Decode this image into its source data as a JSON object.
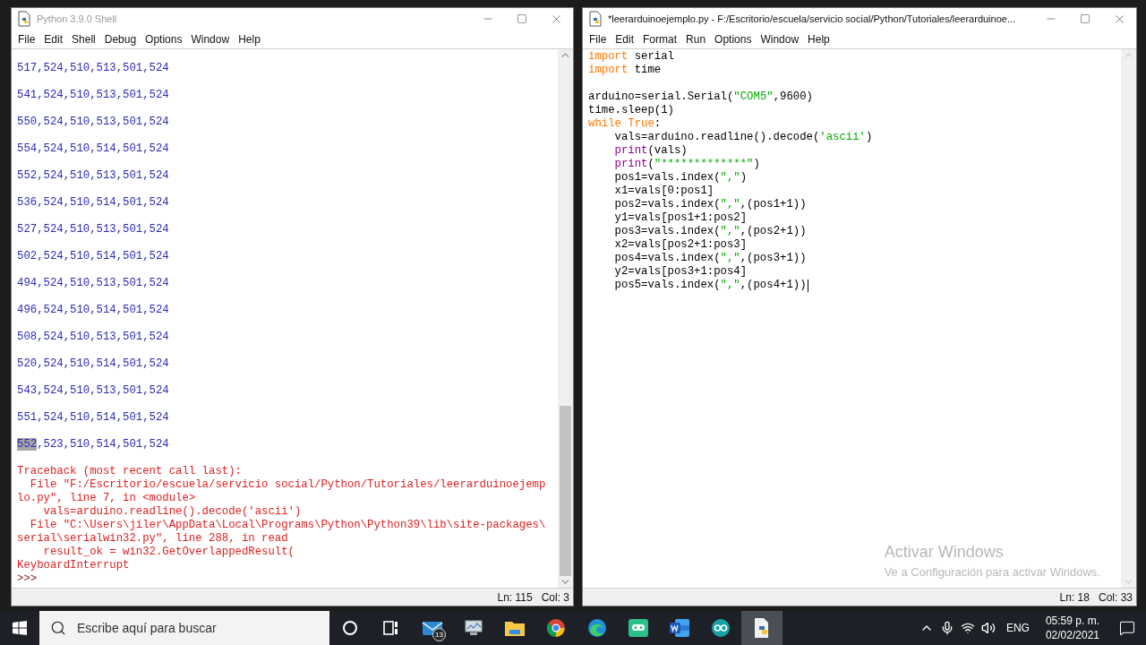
{
  "shell_window": {
    "title": "Python 3.9.0 Shell",
    "active": false,
    "menu": [
      "File",
      "Edit",
      "Shell",
      "Debug",
      "Options",
      "Window",
      "Help"
    ],
    "lines": [
      {
        "kind": "output",
        "text": "517,524,510,513,501,524"
      },
      {
        "kind": "output",
        "text": "541,524,510,513,501,524"
      },
      {
        "kind": "output",
        "text": "550,524,510,513,501,524"
      },
      {
        "kind": "output",
        "text": "554,524,510,514,501,524"
      },
      {
        "kind": "output",
        "text": "552,524,510,513,501,524"
      },
      {
        "kind": "output",
        "text": "536,524,510,514,501,524"
      },
      {
        "kind": "output",
        "text": "527,524,510,513,501,524"
      },
      {
        "kind": "output",
        "text": "502,524,510,514,501,524"
      },
      {
        "kind": "output",
        "text": "494,524,510,513,501,524"
      },
      {
        "kind": "output",
        "text": "496,524,510,514,501,524"
      },
      {
        "kind": "output",
        "text": "508,524,510,513,501,524"
      },
      {
        "kind": "output",
        "text": "520,524,510,514,501,524"
      },
      {
        "kind": "output",
        "text": "543,524,510,513,501,524"
      },
      {
        "kind": "output",
        "text": "551,524,510,514,501,524"
      },
      {
        "kind": "output",
        "segments": [
          {
            "text": "552",
            "selected": true
          },
          {
            "text": ",523,510,514,501,524",
            "selected": false
          }
        ]
      },
      {
        "kind": "error",
        "text": "Traceback (most recent call last):"
      },
      {
        "kind": "error",
        "text": "  File \"F:/Escritorio/escuela/servicio social/Python/Tutoriales/leerarduinoejemp"
      },
      {
        "kind": "error",
        "text": "lo.py\", line 7, in <module>"
      },
      {
        "kind": "error",
        "text": "    vals=arduino.readline().decode('ascii')"
      },
      {
        "kind": "error",
        "text": "  File \"C:\\Users\\jiler\\AppData\\Local\\Programs\\Python\\Python39\\lib\\site-packages\\"
      },
      {
        "kind": "error",
        "text": "serial\\serialwin32.py\", line 288, in read"
      },
      {
        "kind": "error",
        "text": "    result_ok = win32.GetOverlappedResult("
      },
      {
        "kind": "error",
        "text": "KeyboardInterrupt"
      },
      {
        "kind": "prompt",
        "text": ">>>"
      }
    ],
    "status": {
      "line": "Ln: 115",
      "col": "Col: 3"
    }
  },
  "editor_window": {
    "title": "*leerarduinoejemplo.py - F:/Escritorio/escuela/servicio social/Python/Tutoriales/leerarduinoe...",
    "active": true,
    "menu": [
      "File",
      "Edit",
      "Format",
      "Run",
      "Options",
      "Window",
      "Help"
    ],
    "lines": [
      {
        "segments": [
          {
            "text": "import",
            "kind": "keyword"
          },
          {
            "text": " serial",
            "kind": "plain"
          }
        ]
      },
      {
        "segments": [
          {
            "text": "import",
            "kind": "keyword"
          },
          {
            "text": " time",
            "kind": "plain"
          }
        ]
      },
      {
        "gap_before": true,
        "segments": [
          {
            "text": "arduino=serial.Serial(",
            "kind": "plain"
          },
          {
            "text": "\"COM5\"",
            "kind": "string"
          },
          {
            "text": ",9600)",
            "kind": "plain"
          }
        ]
      },
      {
        "segments": [
          {
            "text": "time.sleep(1)",
            "kind": "plain"
          }
        ]
      },
      {
        "segments": [
          {
            "text": "while True",
            "kind": "keyword"
          },
          {
            "text": ":",
            "kind": "plain"
          }
        ]
      },
      {
        "indent": true,
        "segments": [
          {
            "text": "vals=arduino.readline().decode(",
            "kind": "plain"
          },
          {
            "text": "'ascii'",
            "kind": "string"
          },
          {
            "text": ")",
            "kind": "plain"
          }
        ]
      },
      {
        "indent": true,
        "segments": [
          {
            "text": "print",
            "kind": "builtin"
          },
          {
            "text": "(vals)",
            "kind": "plain"
          }
        ]
      },
      {
        "indent": true,
        "segments": [
          {
            "text": "print",
            "kind": "builtin"
          },
          {
            "text": "(",
            "kind": "plain"
          },
          {
            "text": "\"*************\"",
            "kind": "string"
          },
          {
            "text": ")",
            "kind": "plain"
          }
        ]
      },
      {
        "indent": true,
        "segments": [
          {
            "text": "pos1=vals.index(",
            "kind": "plain"
          },
          {
            "text": "\",\"",
            "kind": "string"
          },
          {
            "text": ")",
            "kind": "plain"
          }
        ]
      },
      {
        "indent": true,
        "segments": [
          {
            "text": "x1=vals[0:pos1]",
            "kind": "plain"
          }
        ]
      },
      {
        "indent": true,
        "segments": [
          {
            "text": "pos2=vals.index(",
            "kind": "plain"
          },
          {
            "text": "\",\"",
            "kind": "string"
          },
          {
            "text": ",(pos1+1))",
            "kind": "plain"
          }
        ]
      },
      {
        "indent": true,
        "segments": [
          {
            "text": "y1=vals[pos1+1:pos2]",
            "kind": "plain"
          }
        ]
      },
      {
        "indent": true,
        "segments": [
          {
            "text": "pos3=vals.index(",
            "kind": "plain"
          },
          {
            "text": "\",\"",
            "kind": "string"
          },
          {
            "text": ",(pos2+1))",
            "kind": "plain"
          }
        ]
      },
      {
        "indent": true,
        "segments": [
          {
            "text": "x2=vals[pos2+1:pos3]",
            "kind": "plain"
          }
        ]
      },
      {
        "indent": true,
        "segments": [
          {
            "text": "pos4=vals.index(",
            "kind": "plain"
          },
          {
            "text": "\",\"",
            "kind": "string"
          },
          {
            "text": ",(pos3+1))",
            "kind": "plain"
          }
        ]
      },
      {
        "indent": true,
        "segments": [
          {
            "text": "y2=vals[pos3+1:pos4]",
            "kind": "plain"
          }
        ]
      },
      {
        "indent": true,
        "caret": true,
        "segments": [
          {
            "text": "pos5=vals.index(",
            "kind": "plain"
          },
          {
            "text": "\",\"",
            "kind": "string"
          },
          {
            "text": ",(pos4+1))",
            "kind": "plain"
          }
        ]
      }
    ],
    "activation_notice": {
      "title": "Activar Windows",
      "text": "Ve a Configuración para activar Windows."
    },
    "status": {
      "line": "Ln: 18",
      "col": "Col: 33"
    }
  },
  "taskbar": {
    "search": {
      "placeholder": "Escribe aquí para buscar"
    },
    "apps": [
      {
        "kind": "cortana",
        "selected": false
      },
      {
        "kind": "task-view",
        "selected": false
      },
      {
        "kind": "mail",
        "badge": "13",
        "selected": false
      },
      {
        "kind": "monitor",
        "selected": false
      },
      {
        "kind": "folder",
        "selected": false
      },
      {
        "kind": "chrome",
        "selected": false
      },
      {
        "kind": "edge",
        "selected": false
      },
      {
        "kind": "chat",
        "selected": false
      },
      {
        "kind": "word",
        "selected": false
      },
      {
        "kind": "arduino",
        "selected": false
      },
      {
        "kind": "python",
        "selected": true
      }
    ],
    "tray": {
      "language": "ENG",
      "time": "05:59 p. m.",
      "date": "02/02/2021"
    }
  }
}
